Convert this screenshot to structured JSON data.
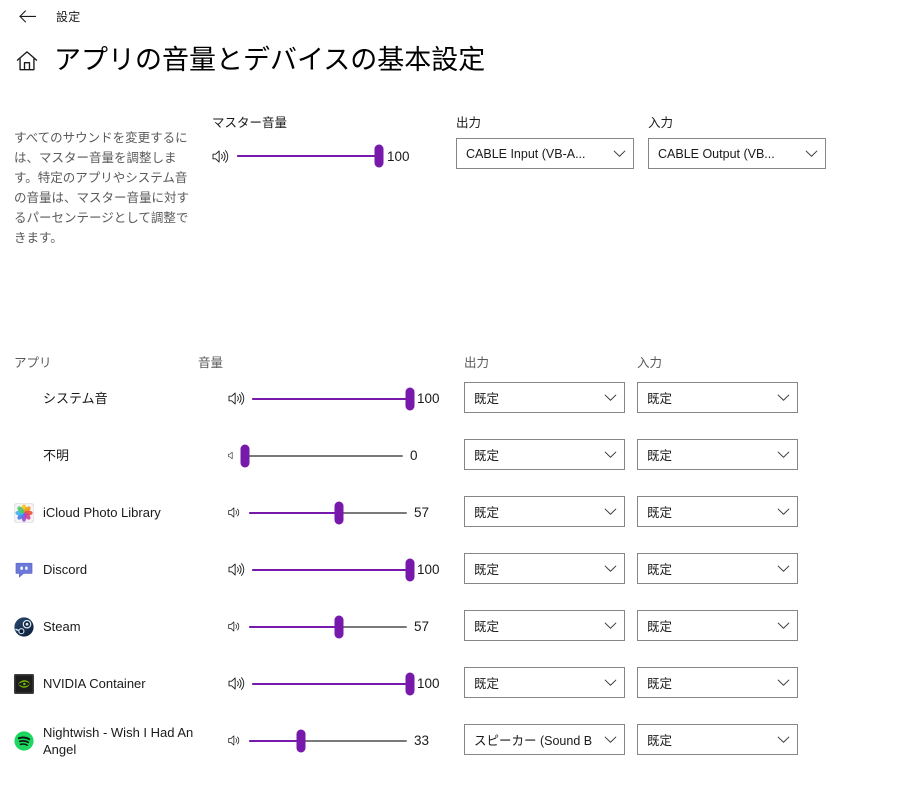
{
  "window": {
    "back_icon": "back-arrow-icon",
    "title": "設定"
  },
  "header": {
    "home_icon": "home-icon",
    "title": "アプリの音量とデバイスの基本設定"
  },
  "master": {
    "description": "すべてのサウンドを変更するには、マスター音量を調整します。特定のアプリやシステム音の音量は、マスター音量に対するパーセンテージとして調整できます。",
    "volume_label": "マスター音量",
    "volume_value": 100,
    "volume_text": "100",
    "speaker_icon": "speaker-high-icon",
    "output_label": "出力",
    "output_value": "CABLE Input (VB-A...",
    "input_label": "入力",
    "input_value": "CABLE Output (VB..."
  },
  "apps_table": {
    "headers": {
      "app": "アプリ",
      "volume": "音量",
      "output": "出力",
      "input": "入力"
    },
    "rows": [
      {
        "name": "システム音",
        "icon": "none",
        "volume": 100,
        "volume_text": "100",
        "speaker_icon": "speaker-high-icon",
        "output": "既定",
        "input": "既定"
      },
      {
        "name": "不明",
        "icon": "none",
        "volume": 0,
        "volume_text": "0",
        "speaker_icon": "speaker-mute-icon",
        "output": "既定",
        "input": "既定"
      },
      {
        "name": "iCloud Photo Library",
        "icon": "icloud-photos-icon",
        "volume": 57,
        "volume_text": "57",
        "speaker_icon": "speaker-mid-icon",
        "output": "既定",
        "input": "既定"
      },
      {
        "name": "Discord",
        "icon": "discord-icon",
        "volume": 100,
        "volume_text": "100",
        "speaker_icon": "speaker-high-icon",
        "output": "既定",
        "input": "既定"
      },
      {
        "name": "Steam",
        "icon": "steam-icon",
        "volume": 57,
        "volume_text": "57",
        "speaker_icon": "speaker-mid-icon",
        "output": "既定",
        "input": "既定"
      },
      {
        "name": "NVIDIA Container",
        "icon": "nvidia-icon",
        "volume": 100,
        "volume_text": "100",
        "speaker_icon": "speaker-high-icon",
        "output": "既定",
        "input": "既定"
      },
      {
        "name": "Nightwish - Wish I Had An Angel",
        "icon": "spotify-icon",
        "volume": 33,
        "volume_text": "33",
        "speaker_icon": "speaker-mid-icon",
        "output": "スピーカー (Sound B",
        "input": "既定"
      }
    ]
  },
  "colors": {
    "accent": "#7719aa",
    "track": "#7a7a7a",
    "combo_border": "#868686",
    "secondary_text": "#5a5a5a"
  }
}
